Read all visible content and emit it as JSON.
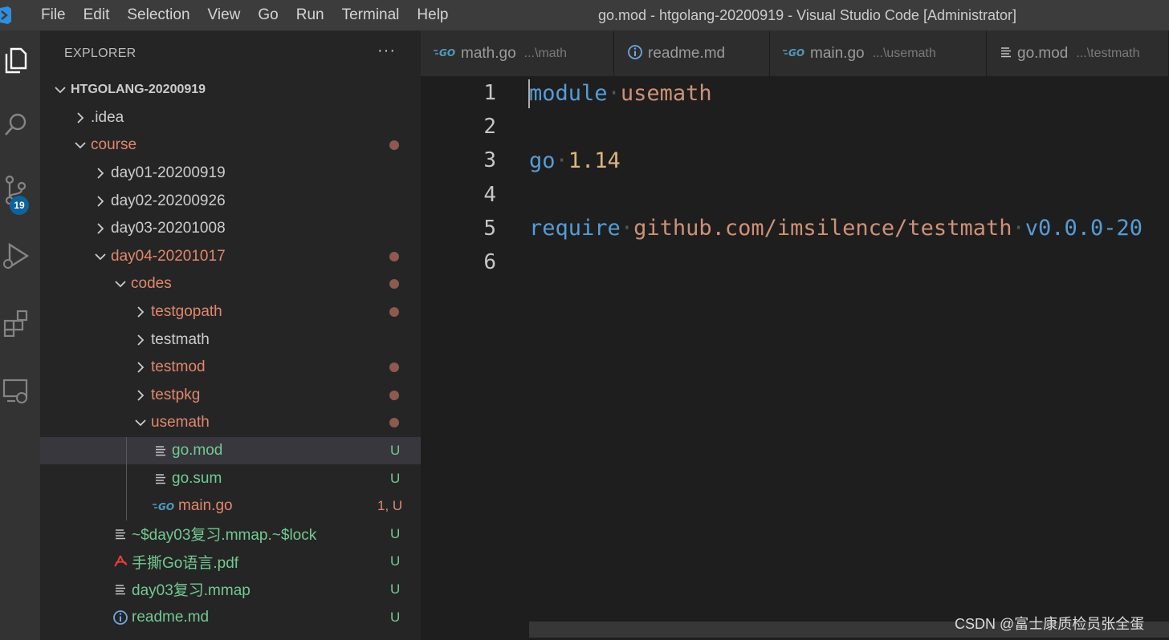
{
  "titlebar": {
    "menu": [
      "File",
      "Edit",
      "Selection",
      "View",
      "Go",
      "Run",
      "Terminal",
      "Help"
    ],
    "window_title": "go.mod - htgolang-20200919 - Visual Studio Code [Administrator]"
  },
  "activitybar": {
    "icons": [
      "explorer-icon",
      "search-icon",
      "source-control-icon",
      "run-debug-icon",
      "extensions-icon",
      "remote-explorer-icon"
    ],
    "source_control_badge": "19"
  },
  "sidebar": {
    "header": "EXPLORER",
    "more": "···",
    "tree": [
      {
        "label": "HTGOLANG-20200919",
        "depth": 0,
        "type": "root",
        "expanded": true,
        "color": "plain",
        "status": ""
      },
      {
        "label": ".idea",
        "depth": 1,
        "type": "folder",
        "expanded": false,
        "color": "plain",
        "status": ""
      },
      {
        "label": "course",
        "depth": 1,
        "type": "folder",
        "expanded": true,
        "color": "mod",
        "status": "dot"
      },
      {
        "label": "day01-20200919",
        "depth": 2,
        "type": "folder",
        "expanded": false,
        "color": "plain",
        "status": ""
      },
      {
        "label": "day02-20200926",
        "depth": 2,
        "type": "folder",
        "expanded": false,
        "color": "plain",
        "status": ""
      },
      {
        "label": "day03-20201008",
        "depth": 2,
        "type": "folder",
        "expanded": false,
        "color": "plain",
        "status": ""
      },
      {
        "label": "day04-20201017",
        "depth": 2,
        "type": "folder",
        "expanded": true,
        "color": "mod",
        "status": "dot"
      },
      {
        "label": "codes",
        "depth": 3,
        "type": "folder",
        "expanded": true,
        "color": "mod",
        "status": "dot"
      },
      {
        "label": "testgopath",
        "depth": 4,
        "type": "folder",
        "expanded": false,
        "color": "mod",
        "status": "dot"
      },
      {
        "label": "testmath",
        "depth": 4,
        "type": "folder",
        "expanded": false,
        "color": "plain",
        "status": ""
      },
      {
        "label": "testmod",
        "depth": 4,
        "type": "folder",
        "expanded": false,
        "color": "mod",
        "status": "dot"
      },
      {
        "label": "testpkg",
        "depth": 4,
        "type": "folder",
        "expanded": false,
        "color": "mod",
        "status": "dot"
      },
      {
        "label": "usemath",
        "depth": 4,
        "type": "folder",
        "expanded": true,
        "color": "mod",
        "status": "dot"
      },
      {
        "label": "go.mod",
        "depth": 5,
        "type": "file-lines",
        "color": "new",
        "status": "U",
        "selected": true
      },
      {
        "label": "go.sum",
        "depth": 5,
        "type": "file-lines",
        "color": "new",
        "status": "U"
      },
      {
        "label": "main.go",
        "depth": 5,
        "type": "file-go",
        "color": "err",
        "status": "1, U"
      },
      {
        "label": "~$day03复习.mmap.~$lock",
        "depth": 3,
        "type": "file-lines",
        "color": "new",
        "status": "U"
      },
      {
        "label": "手撕Go语言.pdf",
        "depth": 3,
        "type": "file-pdf",
        "color": "new",
        "status": "U"
      },
      {
        "label": "day03复习.mmap",
        "depth": 3,
        "type": "file-lines",
        "color": "new",
        "status": "U"
      },
      {
        "label": "readme.md",
        "depth": 3,
        "type": "file-info",
        "color": "new",
        "status": "U"
      }
    ]
  },
  "tabs": [
    {
      "name": "math.go",
      "path": "...\\math",
      "icon": "go-file-icon"
    },
    {
      "name": "readme.md",
      "path": "",
      "icon": "info-icon"
    },
    {
      "name": "main.go",
      "path": "...\\usemath",
      "icon": "go-file-icon"
    },
    {
      "name": "go.mod",
      "path": "...\\testmath",
      "icon": "lines-file-icon"
    }
  ],
  "editor": {
    "line_numbers": [
      "1",
      "2",
      "3",
      "4",
      "5",
      "6"
    ],
    "lines": [
      [
        {
          "t": "module",
          "c": "kw"
        },
        {
          "t": "·",
          "c": "ws"
        },
        {
          "t": "usemath",
          "c": "str"
        }
      ],
      [],
      [
        {
          "t": "go",
          "c": "kw"
        },
        {
          "t": "·",
          "c": "ws"
        },
        {
          "t": "1.14",
          "c": "num2"
        }
      ],
      [],
      [
        {
          "t": "require",
          "c": "kw"
        },
        {
          "t": "·",
          "c": "ws"
        },
        {
          "t": "github.com/imsilence/testmath",
          "c": "str"
        },
        {
          "t": "·",
          "c": "ws"
        },
        {
          "t": "v0.0.0-20",
          "c": "kw"
        }
      ],
      []
    ]
  },
  "watermark": "CSDN @富士康质检员张全蛋",
  "colors": {
    "titlebar": "#3c3c3c",
    "activitybar": "#333333",
    "sidebar": "#252526",
    "editor": "#1e1e1e",
    "modified": "#e2876c",
    "untracked": "#73c991",
    "keyword": "#569cd6",
    "string": "#ce9178",
    "badge": "#0e639c"
  }
}
